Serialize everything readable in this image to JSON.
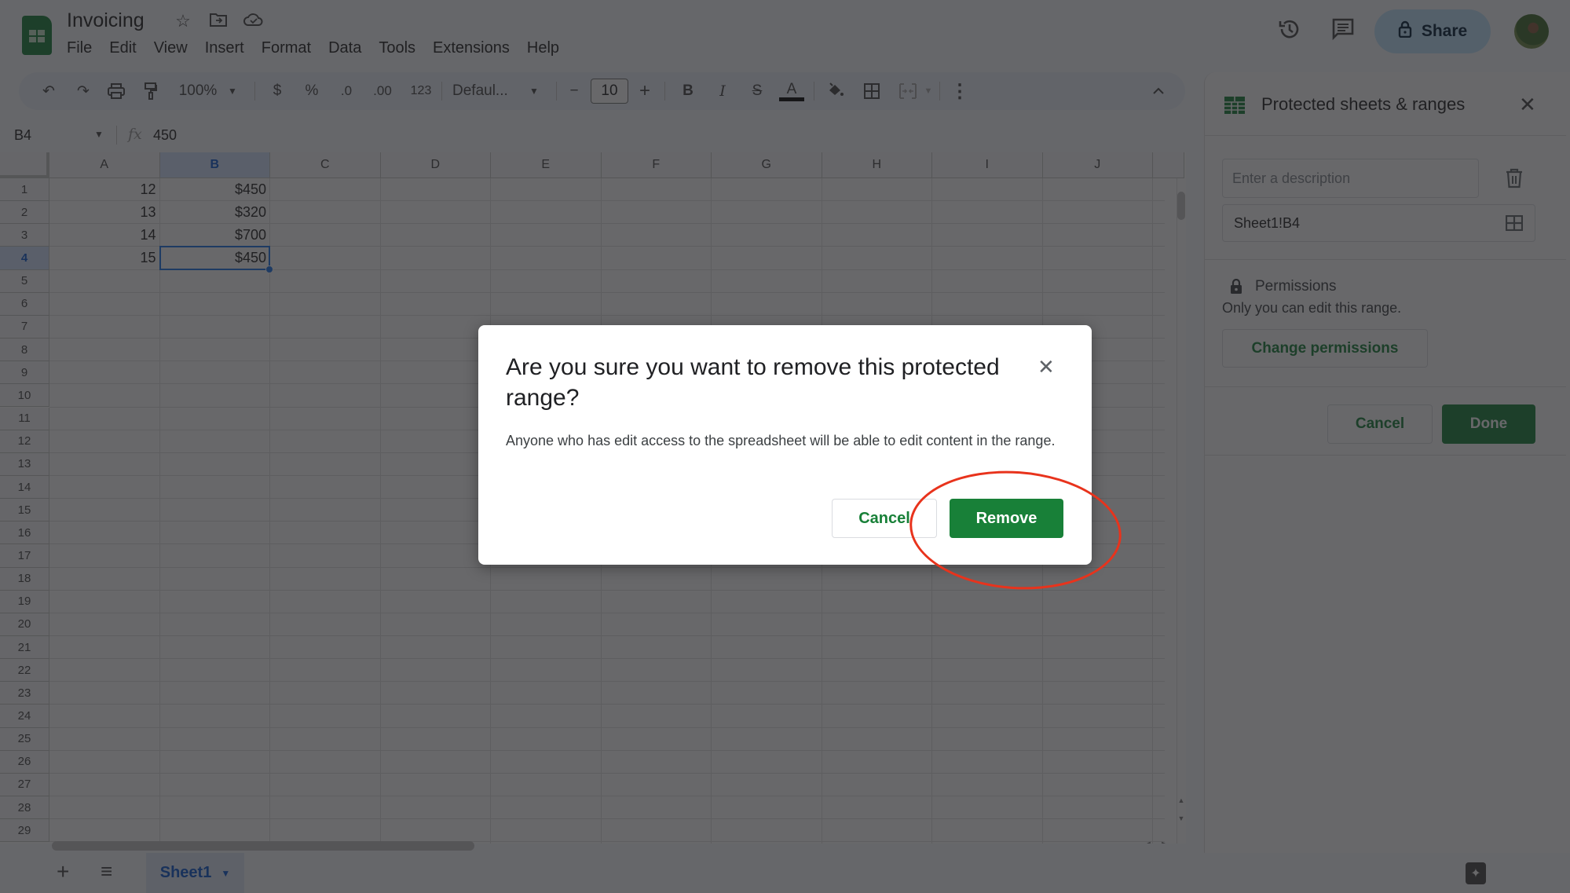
{
  "app": {
    "title": "Invoicing",
    "menu": [
      "File",
      "Edit",
      "View",
      "Insert",
      "Format",
      "Data",
      "Tools",
      "Extensions",
      "Help"
    ],
    "share_label": "Share",
    "colors": {
      "accent_green": "#188038",
      "selection_blue": "#1a73e8",
      "annotation_red": "#e8331c"
    }
  },
  "toolbar": {
    "zoom": "100%",
    "currency": "$",
    "percent": "%",
    "decrease_decimal": ".0",
    "increase_decimal": ".00",
    "number_format": "123",
    "font": "Defaul...",
    "font_size": "10",
    "bold": "B",
    "italic": "I",
    "text_color": "A"
  },
  "formula_bar": {
    "name_box": "B4",
    "fx": "fx",
    "value": "450"
  },
  "grid": {
    "columns": [
      "A",
      "B",
      "C",
      "D",
      "E",
      "F",
      "G",
      "H",
      "I",
      "J"
    ],
    "selected_column": "B",
    "selected_row": 4,
    "row_count": 29,
    "cells": [
      {
        "ref": "A1",
        "value": "12"
      },
      {
        "ref": "B1",
        "value": "$450"
      },
      {
        "ref": "A2",
        "value": "13"
      },
      {
        "ref": "B2",
        "value": "$320"
      },
      {
        "ref": "A3",
        "value": "14"
      },
      {
        "ref": "B3",
        "value": "$700"
      },
      {
        "ref": "A4",
        "value": "15"
      },
      {
        "ref": "B4",
        "value": "$450"
      }
    ]
  },
  "sheets": {
    "tabs": [
      {
        "label": "Sheet1",
        "active": true
      }
    ]
  },
  "side_panel": {
    "title": "Protected sheets & ranges",
    "description_placeholder": "Enter a description",
    "description_value": "",
    "range": "Sheet1!B4",
    "permissions_title": "Permissions",
    "permissions_desc": "Only you can edit this range.",
    "change_permissions_label": "Change permissions",
    "cancel_label": "Cancel",
    "done_label": "Done"
  },
  "dialog": {
    "title": "Are you sure you want to remove this protected range?",
    "body": "Anyone who has edit access to the spreadsheet will be able to edit content in the range.",
    "cancel_label": "Cancel",
    "remove_label": "Remove"
  }
}
